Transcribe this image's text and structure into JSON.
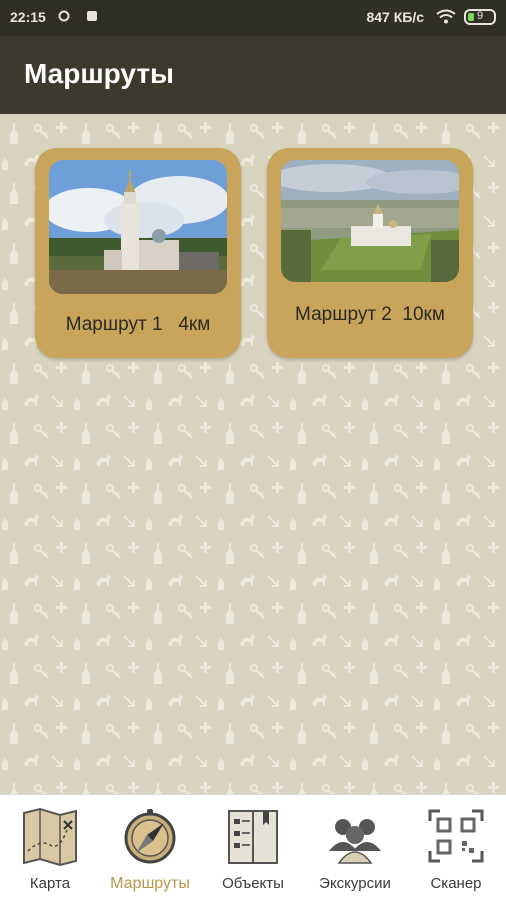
{
  "status_bar": {
    "time": "22:15",
    "speed": "847 КБ/с",
    "battery": "9"
  },
  "app_bar": {
    "title": "Маршруты"
  },
  "routes": [
    {
      "label": "Маршрут 1   4км"
    },
    {
      "label": "Маршрут 2  10км"
    }
  ],
  "bottom_nav": {
    "items": [
      {
        "label": "Карта",
        "icon": "map-icon"
      },
      {
        "label": "Маршруты",
        "icon": "compass-icon",
        "active": true
      },
      {
        "label": "Объекты",
        "icon": "book-icon"
      },
      {
        "label": "Экскурсии",
        "icon": "group-icon"
      },
      {
        "label": "Сканер",
        "icon": "qr-scanner-icon"
      }
    ]
  },
  "colors": {
    "app_bar": "#3c3a2c",
    "status_bar": "#2f2f24",
    "background": "#d9d4c0",
    "card": "#c9a55c",
    "active_tab": "#b7954a"
  }
}
